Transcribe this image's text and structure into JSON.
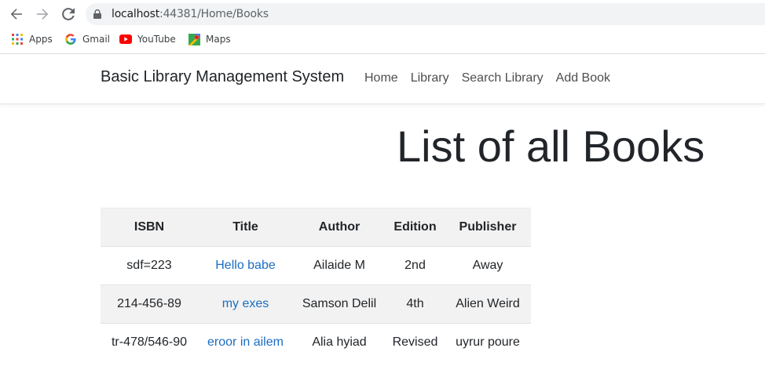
{
  "browser": {
    "url_host": "localhost",
    "url_rest": ":44381/Home/Books",
    "bookmarks": [
      {
        "label": "Apps",
        "icon": "apps-grid-icon"
      },
      {
        "label": "Gmail",
        "icon": "google-icon"
      },
      {
        "label": "YouTube",
        "icon": "youtube-icon"
      },
      {
        "label": "Maps",
        "icon": "maps-icon"
      }
    ]
  },
  "navbar": {
    "brand": "Basic Library Management System",
    "links": [
      "Home",
      "Library",
      "Search Library",
      "Add Book"
    ]
  },
  "page": {
    "title": "List of all Books"
  },
  "table": {
    "headers": [
      "ISBN",
      "Title",
      "Author",
      "Edition",
      "Publisher"
    ],
    "rows": [
      {
        "isbn": "sdf=223",
        "title": "Hello babe",
        "author": "Ailaide M",
        "edition": "2nd",
        "publisher": "Away"
      },
      {
        "isbn": "214-456-89",
        "title": "my exes",
        "author": "Samson Delil",
        "edition": "4th",
        "publisher": "Alien Weird"
      },
      {
        "isbn": "tr-478/546-90",
        "title": "eroor in ailem",
        "author": "Alia hyiad",
        "edition": "Revised",
        "publisher": "uyrur poure"
      }
    ]
  },
  "colors": {
    "link": "#1b6ec2",
    "stripe": "#f2f2f2",
    "omnibox": "#f1f3f4"
  }
}
